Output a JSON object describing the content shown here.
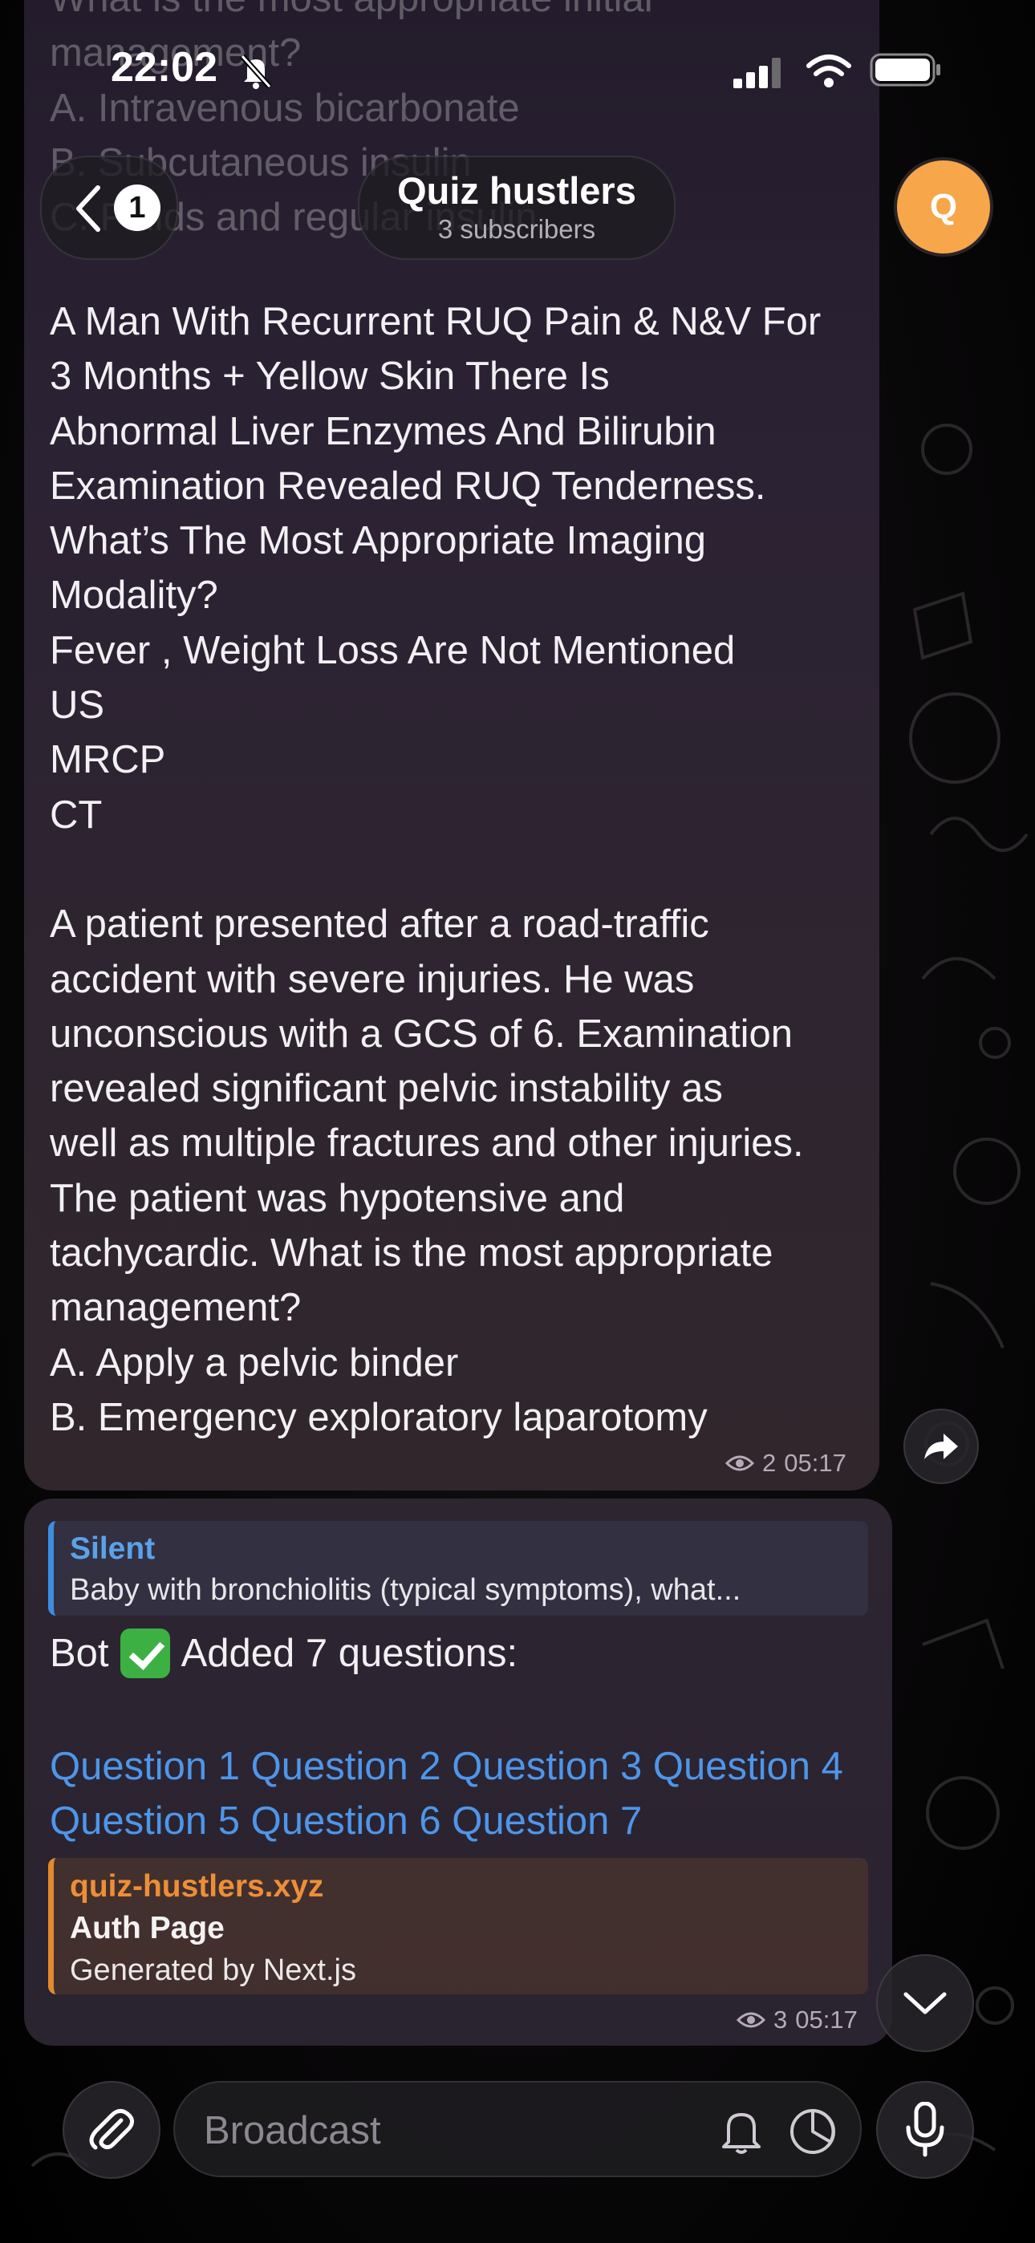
{
  "status_bar": {
    "time": "22:02"
  },
  "header": {
    "back_badge": "1",
    "channel_name": "Quiz hustlers",
    "subscribers": "3 subscribers",
    "avatar_letter": "Q"
  },
  "ghost_text": [
    "What is the most appropriate initial",
    "management?",
    "A. Intravenous bicarbonate",
    "B. Subcutaneous insulin",
    "C. Fluids and regular insulin"
  ],
  "message_1": {
    "lines": [
      "A Man With Recurrent RUQ Pain & N&V For",
      "3 Months + Yellow Skin There Is",
      "Abnormal Liver Enzymes And Bilirubin",
      "Examination Revealed RUQ Tenderness.",
      "What’s The Most Appropriate Imaging",
      "Modality?",
      "Fever , Weight Loss Are Not Mentioned",
      "US",
      "MRCP",
      "CT"
    ],
    "lines_2": [
      "A patient presented after a road-traffic",
      "accident with severe injuries. He was",
      "unconscious with a GCS of 6. Examination",
      "revealed significant pelvic instability as",
      "well as multiple fractures and other injuries.",
      "The patient was hypotensive and",
      "tachycardic. What is the most appropriate",
      "management?",
      "A. Apply a pelvic binder",
      "B. Emergency exploratory laparotomy"
    ],
    "views": "2",
    "time": "05:17"
  },
  "message_2": {
    "reply_name": "Silent",
    "reply_text": "Baby with bronchiolitis (typical symptoms), what...",
    "bot_prefix": "Bot",
    "bot_text": "Added 7 questions:",
    "links": [
      "Question 1",
      "Question 2",
      "Question 3",
      "Question 4",
      "Question 5",
      "Question 6",
      "Question 7"
    ],
    "preview_site": "quiz-hustlers.xyz",
    "preview_title": "Auth Page",
    "preview_desc": "Generated by Next.js",
    "views": "3",
    "time": "05:17"
  },
  "input": {
    "placeholder": "Broadcast"
  },
  "colors": {
    "accent_blue": "#4d96ea",
    "preview_orange": "#ee8e36",
    "avatar": "#f7a64a",
    "check_green": "#3cb043"
  },
  "icons": [
    "silent-bell-icon",
    "signal-icon",
    "wifi-icon",
    "battery-icon",
    "chevron-left-icon",
    "share-icon",
    "eye-icon",
    "chevron-down-icon",
    "paperclip-icon",
    "bell-icon",
    "timer-icon",
    "microphone-icon"
  ]
}
